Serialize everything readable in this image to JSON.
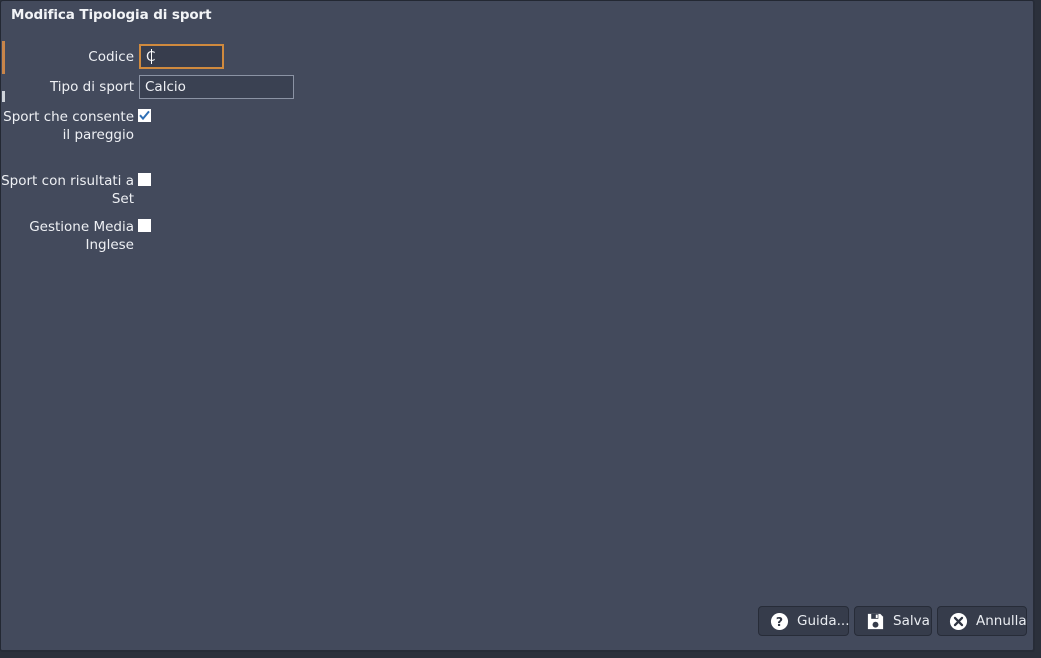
{
  "window": {
    "title": "Modifica Tipologia di sport",
    "background_color": "#434a5c",
    "desktop_color": "#2b303b"
  },
  "form": {
    "fields": [
      {
        "id": "codice",
        "label": "Codice",
        "type": "text",
        "value": "C",
        "focused": true,
        "focus_border_color": "#d08a3e"
      },
      {
        "id": "tipo-di-sport",
        "label": "Tipo di sport",
        "type": "text",
        "value": "Calcio",
        "focused": false,
        "border_color": "#8b93a4"
      },
      {
        "id": "sport-pareggio",
        "label": "Sport che consente il pareggio",
        "type": "checkbox",
        "checked": true,
        "check_color": "#2f6fb5"
      },
      {
        "id": "sport-risultati-set",
        "label": "Sport con risultati a Set",
        "type": "checkbox",
        "checked": false
      },
      {
        "id": "gestione-media-inglese",
        "label": "Gestione Media Inglese",
        "type": "checkbox",
        "checked": false
      }
    ]
  },
  "buttons": [
    {
      "id": "guida",
      "label": "Guida...",
      "icon": "help-circle-icon"
    },
    {
      "id": "salva",
      "label": "Salva",
      "icon": "floppy-disk-save-icon"
    },
    {
      "id": "annulla",
      "label": "Annulla",
      "icon": "cancel-x-circle-icon"
    }
  ]
}
